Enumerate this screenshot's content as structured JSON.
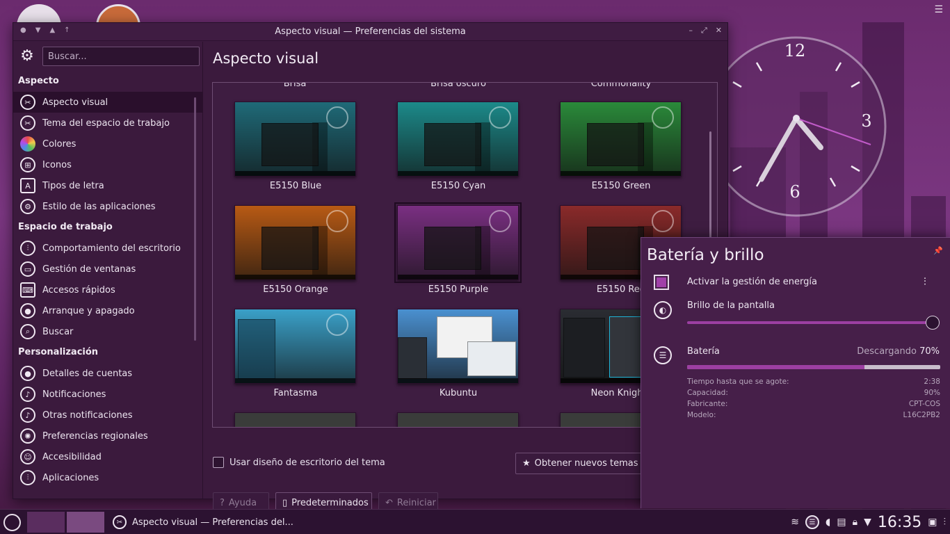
{
  "window": {
    "title": "Aspecto visual — Preferencias del sistema"
  },
  "sidebar": {
    "search_placeholder": "Buscar...",
    "sections": [
      {
        "header": "Aspecto",
        "items": [
          {
            "label": "Aspecto visual",
            "icon": "appearance-icon",
            "active": true
          },
          {
            "label": "Tema del espacio de trabajo",
            "icon": "workspace-theme-icon"
          },
          {
            "label": "Colores",
            "icon": "colors-icon"
          },
          {
            "label": "Iconos",
            "icon": "icons-icon"
          },
          {
            "label": "Tipos de letra",
            "icon": "fonts-icon"
          },
          {
            "label": "Estilo de las aplicaciones",
            "icon": "app-style-icon"
          }
        ]
      },
      {
        "header": "Espacio de trabajo",
        "items": [
          {
            "label": "Comportamiento del escritorio",
            "icon": "desktop-behavior-icon"
          },
          {
            "label": "Gestión de ventanas",
            "icon": "window-management-icon"
          },
          {
            "label": "Accesos rápidos",
            "icon": "shortcuts-icon"
          },
          {
            "label": "Arranque y apagado",
            "icon": "startup-shutdown-icon"
          },
          {
            "label": "Buscar",
            "icon": "search-icon"
          }
        ]
      },
      {
        "header": "Personalización",
        "items": [
          {
            "label": "Detalles de cuentas",
            "icon": "account-icon"
          },
          {
            "label": "Notificaciones",
            "icon": "notifications-icon"
          },
          {
            "label": "Otras notificaciones",
            "icon": "other-notifications-icon"
          },
          {
            "label": "Preferencias regionales",
            "icon": "regional-icon"
          },
          {
            "label": "Accesibilidad",
            "icon": "accessibility-icon"
          },
          {
            "label": "Aplicaciones",
            "icon": "applications-icon"
          }
        ]
      }
    ]
  },
  "main": {
    "title": "Aspecto visual",
    "cut_labels": [
      "Brisa",
      "Brisa oscuro",
      "Commonality"
    ],
    "themes": [
      {
        "name": "E5150 Blue",
        "color": "#1f6a78"
      },
      {
        "name": "E5150 Cyan",
        "color": "#1c8a8a"
      },
      {
        "name": "E5150 Green",
        "color": "#2a8a3a"
      },
      {
        "name": "E5150 Orange",
        "color": "#b85a14"
      },
      {
        "name": "E5150 Purple",
        "color": "#7a2f82",
        "selected": true
      },
      {
        "name": "E5150 Red",
        "color": "#8a2a2a"
      },
      {
        "name": "Fantasma",
        "color": "#3aa0c8"
      },
      {
        "name": "Kubuntu",
        "color": "#4a90d0"
      },
      {
        "name": "Neon Knights",
        "color": "#2a2c32"
      }
    ],
    "use_desktop_layout_label": "Usar diseño de escritorio del tema",
    "get_new_label": "Obtener nuevos temas de",
    "help_label": "Ayuda",
    "defaults_label": "Predeterminados",
    "reset_label": "Reiniciar"
  },
  "clock": {
    "numbers": [
      "12",
      "3",
      "6"
    ]
  },
  "battery_popup": {
    "title": "Batería y brillo",
    "power_management_label": "Activar la gestión de energía",
    "brightness_label": "Brillo de la pantalla",
    "brightness_level": 0.97,
    "battery_label": "Batería",
    "battery_status": "Descargando",
    "battery_percent": "70%",
    "battery_level": 0.7,
    "details": [
      {
        "key": "Tiempo hasta que se agote:",
        "value": "2:38"
      },
      {
        "key": "Capacidad:",
        "value": "90%"
      },
      {
        "key": "Fabricante:",
        "value": "CPT-COS"
      },
      {
        "key": "Modelo:",
        "value": "L16C2PB2"
      }
    ]
  },
  "taskbar": {
    "task_title": "Aspecto visual  — Preferencias del...",
    "time": "16:35"
  }
}
